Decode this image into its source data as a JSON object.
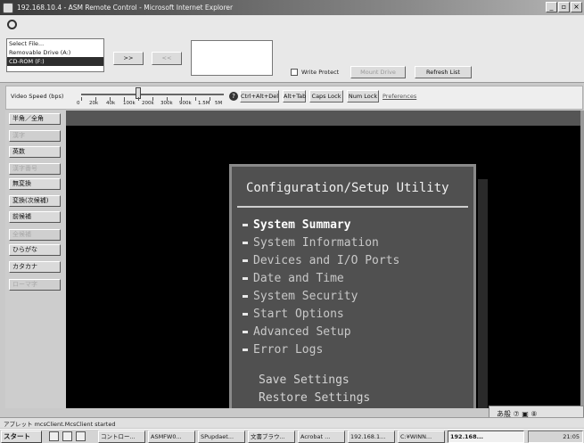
{
  "window": {
    "title": "192.168.10.4 - ASM Remote Control - Microsoft Internet Explorer",
    "controls": [
      "_",
      "▫",
      "×"
    ]
  },
  "drives": {
    "options": [
      "Select File...",
      "Removable Drive (A:)",
      "CD-ROM (F:)"
    ],
    "selected": "CD-ROM (F:)"
  },
  "toolbar": {
    "add_label": ">>",
    "remove_label": "<<",
    "write_protect_label": "Write Protect",
    "mount_label": "Mount Drive",
    "refresh_label": "Refresh List"
  },
  "speed": {
    "label": "Video Speed (bps)",
    "ticks": [
      "0",
      "20k",
      "40k",
      "100k",
      "200k",
      "300k",
      "900k",
      "1.5M",
      "5M"
    ],
    "help_icon": "help-icon",
    "keys": [
      "Ctrl+Alt+Del",
      "Alt+Tab",
      "Caps Lock",
      "Num Lock"
    ],
    "preferences_label": "Preferences"
  },
  "sidebar": {
    "items": [
      {
        "label": "半角／全角",
        "enabled": true
      },
      {
        "label": "漢字",
        "enabled": false
      },
      {
        "label": "英数",
        "enabled": true
      },
      {
        "label": "漢字番号",
        "enabled": false
      },
      {
        "label": "無変換",
        "enabled": true
      },
      {
        "label": "変換(次候補)",
        "enabled": true
      },
      {
        "label": "前候補",
        "enabled": true
      },
      {
        "label": "全候補",
        "enabled": false
      },
      {
        "label": "ひらがな",
        "enabled": true
      },
      {
        "label": "カタカナ",
        "enabled": true
      },
      {
        "label": "ローマ字",
        "enabled": false
      }
    ]
  },
  "remote": {
    "title": "Configuration/Setup Utility",
    "menu": [
      "System Summary",
      "System Information",
      "Devices and I/O Ports",
      "Date and Time",
      "System Security",
      "Start Options",
      "Advanced Setup",
      "Error Logs"
    ],
    "selected_index": 0,
    "actions": [
      "Save Settings",
      "Restore Settings"
    ]
  },
  "status": {
    "text": "アプレット mcsClient.McsClient started",
    "ime_text": "あ般 ⑦ ▣ ⑧"
  },
  "taskbar": {
    "start_label": "スタート",
    "tasks": [
      "コントロー...",
      "ASMFW0...",
      "SPupdaet...",
      "文書ブラウ...",
      "Acrobat ...",
      "192.168.1...",
      "C:¥WINN...",
      "192.168..."
    ],
    "active_index": 7,
    "clock": "21:05"
  },
  "colors": {
    "dialog_bg": "#505050",
    "dialog_border": "#8a8a8a",
    "screen_bg": "#000000",
    "selected_drive_bg": "#2e2e2e"
  }
}
